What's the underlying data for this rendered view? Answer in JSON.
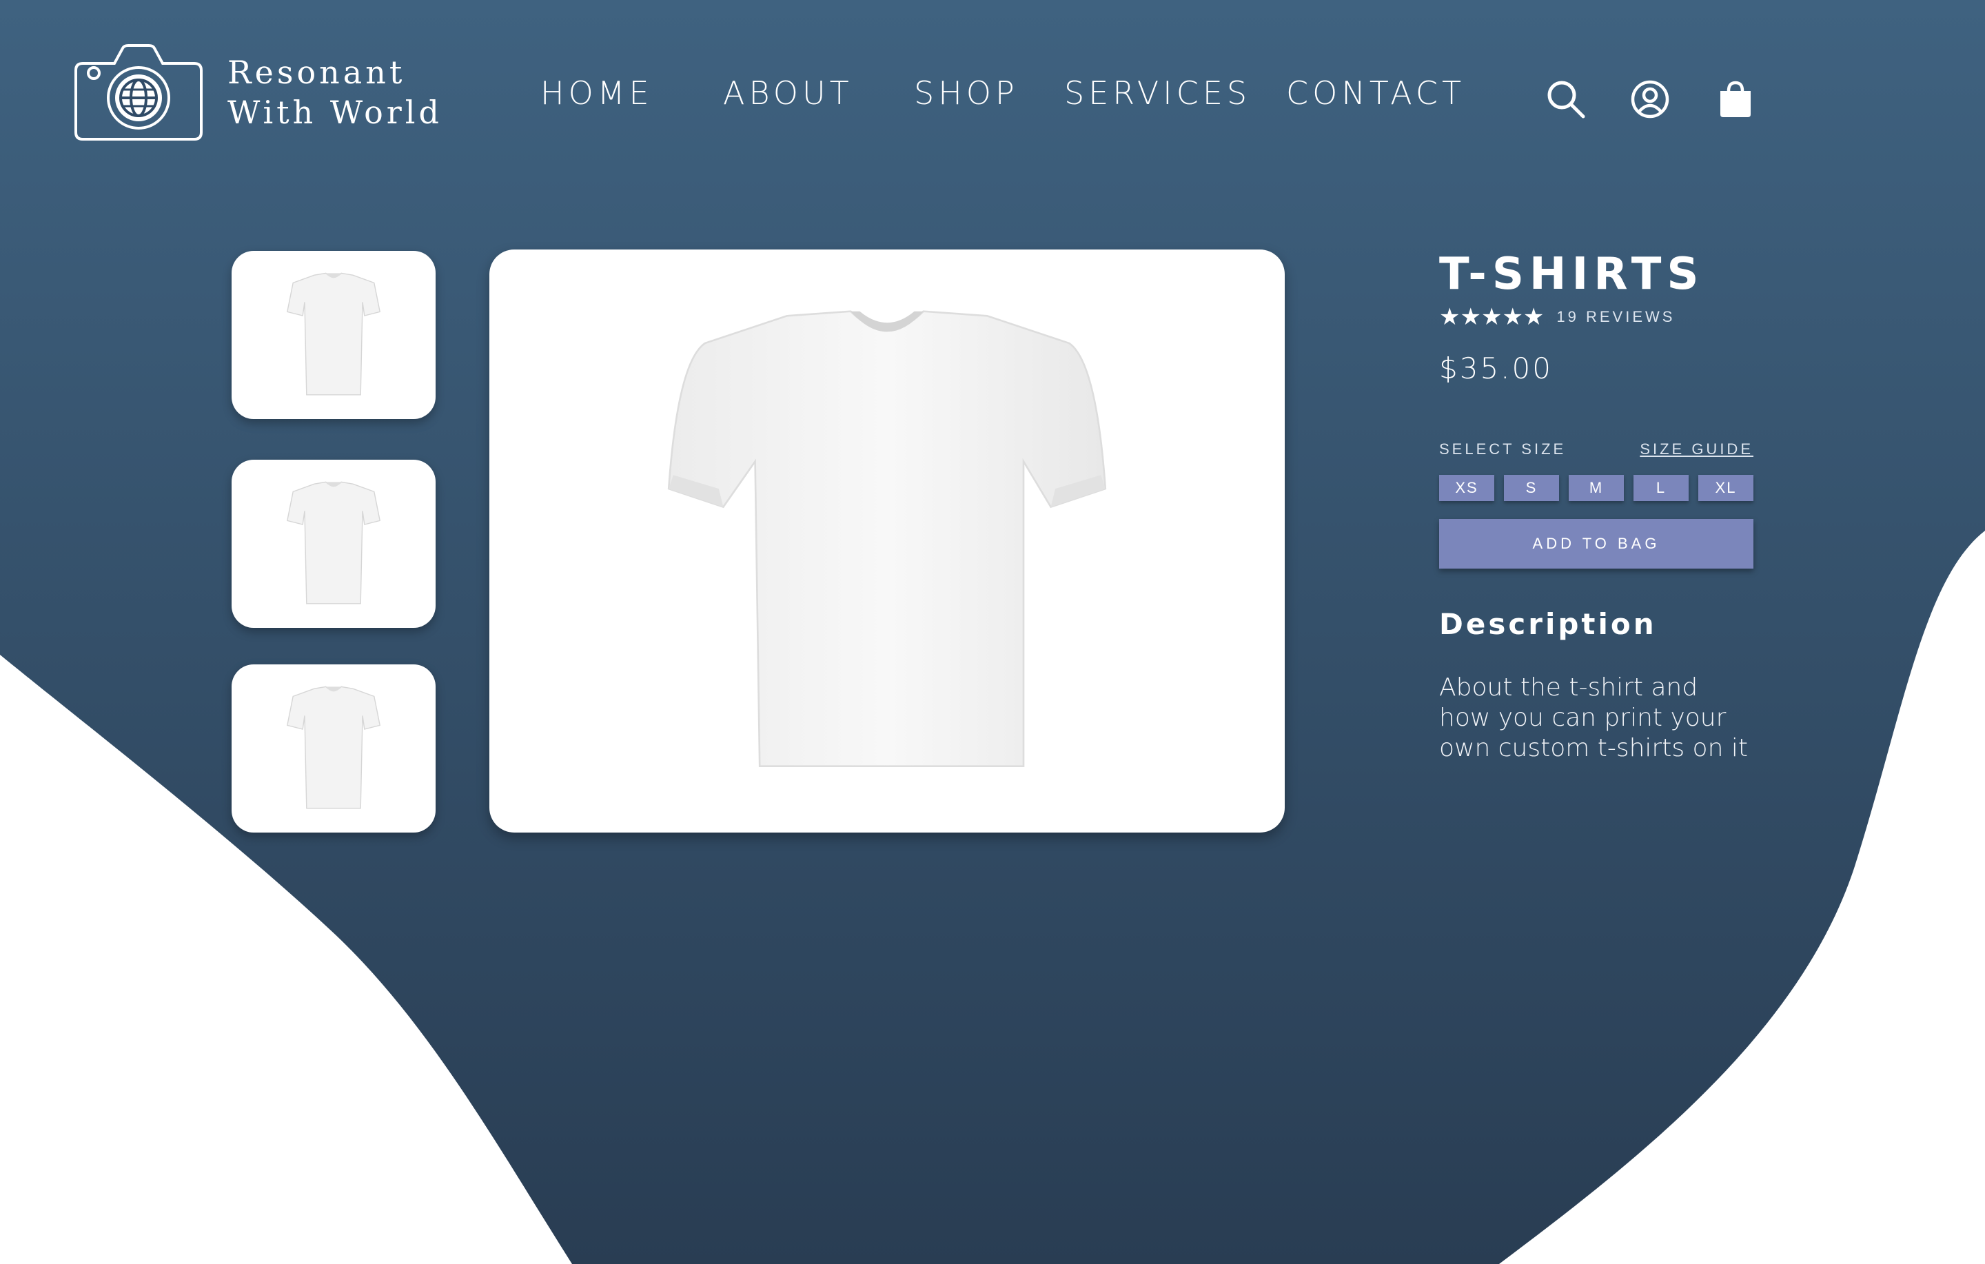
{
  "brand": {
    "line1": "Resonant",
    "line2": "With World"
  },
  "nav": {
    "items": [
      {
        "label": "HOME"
      },
      {
        "label": "ABOUT"
      },
      {
        "label": "SHOP"
      },
      {
        "label": "SERVICES"
      },
      {
        "label": "CONTACT"
      }
    ]
  },
  "header_icons": [
    "search-icon",
    "account-icon",
    "shopping-bag-icon"
  ],
  "product": {
    "title": "T-SHIRTS",
    "stars": "★★★★★",
    "reviews": "19 REVIEWS",
    "price": "$35.00",
    "select_size_label": "SELECT SIZE",
    "size_guide_label": "SIZE GUIDE",
    "sizes": [
      "XS",
      "S",
      "M",
      "L",
      "XL"
    ],
    "add_to_bag_label": "ADD TO BAG",
    "description_heading": "Description",
    "description_text": "About the t-shirt and how you can print your own custom t-shirts on it"
  },
  "colors": {
    "background_top": "#3f6280",
    "background_bottom": "#293d53",
    "accent_button": "#7b86bb",
    "white": "#ffffff"
  }
}
